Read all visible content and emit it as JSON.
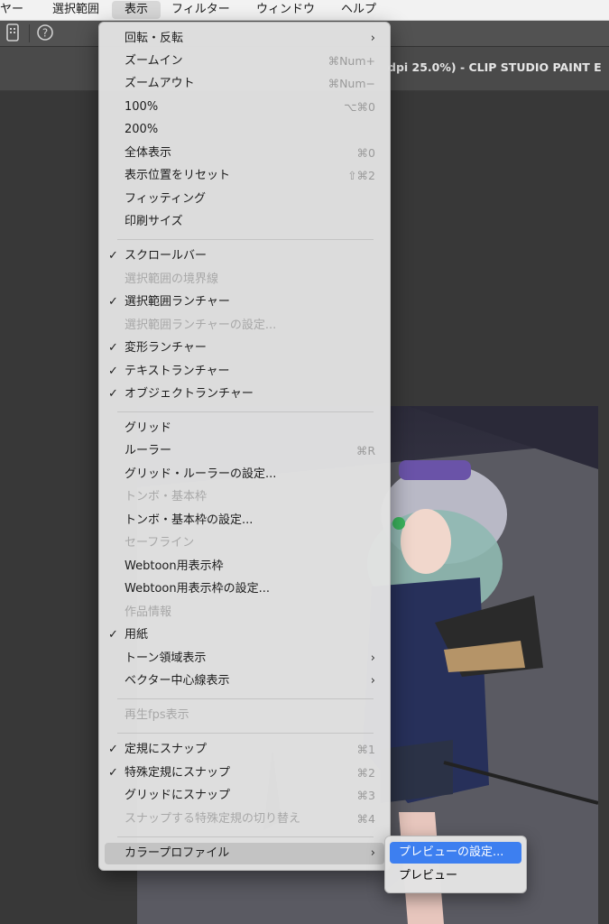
{
  "menubar": {
    "items": [
      "ヤー",
      "選択範囲",
      "表示",
      "フィルター",
      "ウィンドウ",
      "ヘルプ"
    ]
  },
  "window": {
    "title": "dpi 25.0%) - CLIP STUDIO PAINT E"
  },
  "toolbar": {
    "icons": [
      "tablet-icon",
      "help-icon"
    ]
  },
  "menu": {
    "items": [
      {
        "label": "回転・反転",
        "shortcut": "",
        "check": false,
        "disabled": false,
        "submenu": true
      },
      {
        "label": "ズームイン",
        "shortcut": "⌘Num+",
        "check": false,
        "disabled": false,
        "submenu": false
      },
      {
        "label": "ズームアウト",
        "shortcut": "⌘Num−",
        "check": false,
        "disabled": false,
        "submenu": false
      },
      {
        "label": "100%",
        "shortcut": "⌥⌘0",
        "check": false,
        "disabled": false,
        "submenu": false
      },
      {
        "label": "200%",
        "shortcut": "",
        "check": false,
        "disabled": false,
        "submenu": false
      },
      {
        "label": "全体表示",
        "shortcut": "⌘0",
        "check": false,
        "disabled": false,
        "submenu": false
      },
      {
        "label": "表示位置をリセット",
        "shortcut": "⇧⌘2",
        "check": false,
        "disabled": false,
        "submenu": false
      },
      {
        "label": "フィッティング",
        "shortcut": "",
        "check": false,
        "disabled": false,
        "submenu": false
      },
      {
        "label": "印刷サイズ",
        "shortcut": "",
        "check": false,
        "disabled": false,
        "submenu": false
      },
      {
        "label": "スクロールバー",
        "shortcut": "",
        "check": true,
        "disabled": false,
        "submenu": false
      },
      {
        "label": "選択範囲の境界線",
        "shortcut": "",
        "check": false,
        "disabled": true,
        "submenu": false
      },
      {
        "label": "選択範囲ランチャー",
        "shortcut": "",
        "check": true,
        "disabled": false,
        "submenu": false
      },
      {
        "label": "選択範囲ランチャーの設定...",
        "shortcut": "",
        "check": false,
        "disabled": true,
        "submenu": false
      },
      {
        "label": "変形ランチャー",
        "shortcut": "",
        "check": true,
        "disabled": false,
        "submenu": false
      },
      {
        "label": "テキストランチャー",
        "shortcut": "",
        "check": true,
        "disabled": false,
        "submenu": false
      },
      {
        "label": "オブジェクトランチャー",
        "shortcut": "",
        "check": true,
        "disabled": false,
        "submenu": false
      },
      {
        "label": "グリッド",
        "shortcut": "",
        "check": false,
        "disabled": false,
        "submenu": false
      },
      {
        "label": "ルーラー",
        "shortcut": "⌘R",
        "check": false,
        "disabled": false,
        "submenu": false
      },
      {
        "label": "グリッド・ルーラーの設定...",
        "shortcut": "",
        "check": false,
        "disabled": false,
        "submenu": false
      },
      {
        "label": "トンボ・基本枠",
        "shortcut": "",
        "check": false,
        "disabled": true,
        "submenu": false
      },
      {
        "label": "トンボ・基本枠の設定...",
        "shortcut": "",
        "check": false,
        "disabled": false,
        "submenu": false
      },
      {
        "label": "セーフライン",
        "shortcut": "",
        "check": false,
        "disabled": true,
        "submenu": false
      },
      {
        "label": "Webtoon用表示枠",
        "shortcut": "",
        "check": false,
        "disabled": false,
        "submenu": false
      },
      {
        "label": "Webtoon用表示枠の設定...",
        "shortcut": "",
        "check": false,
        "disabled": false,
        "submenu": false
      },
      {
        "label": "作品情報",
        "shortcut": "",
        "check": false,
        "disabled": true,
        "submenu": false
      },
      {
        "label": "用紙",
        "shortcut": "",
        "check": true,
        "disabled": false,
        "submenu": false
      },
      {
        "label": "トーン領域表示",
        "shortcut": "",
        "check": false,
        "disabled": false,
        "submenu": true
      },
      {
        "label": "ベクター中心線表示",
        "shortcut": "",
        "check": false,
        "disabled": false,
        "submenu": true
      },
      {
        "label": "再生fps表示",
        "shortcut": "",
        "check": false,
        "disabled": true,
        "submenu": false
      },
      {
        "label": "定規にスナップ",
        "shortcut": "⌘1",
        "check": true,
        "disabled": false,
        "submenu": false
      },
      {
        "label": "特殊定規にスナップ",
        "shortcut": "⌘2",
        "check": true,
        "disabled": false,
        "submenu": false
      },
      {
        "label": "グリッドにスナップ",
        "shortcut": "⌘3",
        "check": false,
        "disabled": false,
        "submenu": false
      },
      {
        "label": "スナップする特殊定規の切り替え",
        "shortcut": "⌘4",
        "check": false,
        "disabled": true,
        "submenu": false
      },
      {
        "label": "カラープロファイル",
        "shortcut": "",
        "check": false,
        "disabled": false,
        "submenu": true,
        "highlighted": true
      }
    ]
  },
  "submenu": {
    "items": [
      {
        "label": "プレビューの設定...",
        "selected": true
      },
      {
        "label": "プレビュー",
        "selected": false
      }
    ]
  }
}
